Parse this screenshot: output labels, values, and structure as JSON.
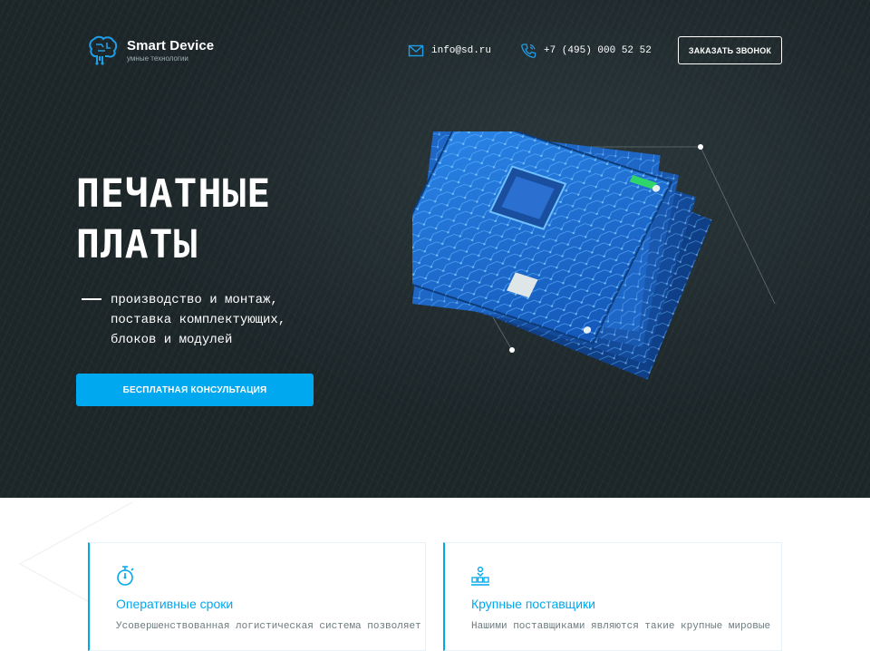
{
  "header": {
    "brand_name": "Smart Device",
    "brand_tagline": "умные технологии",
    "email": "info@sd.ru",
    "phone": "+7 (495) 000 52 52",
    "callback_label": "ЗАКАЗАТЬ ЗВОНОК"
  },
  "hero": {
    "title_line1": "ПЕЧАТНЫЕ",
    "title_line2": "ПЛАТЫ",
    "subtitle_line1": "производство и монтаж,",
    "subtitle_line2": "поставка комплектующих,",
    "subtitle_line3": "блоков и модулей",
    "cta_label": "БЕСПЛАТНАЯ КОНСУЛЬТАЦИЯ"
  },
  "features": [
    {
      "title": "Оперативные сроки",
      "text": "Усовершенствованная логистическая система позволяет",
      "icon": "stopwatch-icon"
    },
    {
      "title": "Крупные поставщики",
      "text": "Нашими поставщиками являются такие крупные мировые",
      "icon": "suppliers-icon"
    }
  ],
  "colors": {
    "accent": "#00a8f0",
    "hero_bg": "#1c2528",
    "pcb_blue": "#1f6fd6"
  }
}
